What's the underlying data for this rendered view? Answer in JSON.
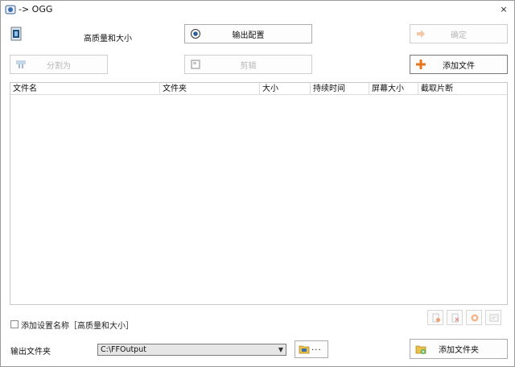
{
  "window": {
    "title": "-> OGG",
    "close_glyph": "×"
  },
  "profile": {
    "label": "高质量和大小"
  },
  "toolbar": {
    "output_config": "输出配置",
    "ok": "确定",
    "split": "分割为",
    "clip": "剪辑",
    "add_file": "添加文件"
  },
  "table": {
    "columns": [
      "文件名",
      "文件夹",
      "大小",
      "持续时间",
      "屏幕大小",
      "截取片断"
    ]
  },
  "options": {
    "append_setting_name": "添加设置名称［高质量和大小］",
    "append_checked": false
  },
  "output": {
    "label": "输出文件夹",
    "folder_value": "C:\\FFOutput",
    "browse_label": "...",
    "add_folder": "添加文件夹"
  },
  "icons": {
    "title": "app-icon",
    "profile": "profile-icon",
    "output_config": "gear-radio-icon",
    "ok": "arrow-right-icon",
    "split": "split-icon",
    "clip": "film-icon",
    "add_file": "plus-icon",
    "remove": "remove-file-icon",
    "clear": "clear-list-icon",
    "play": "play-icon",
    "info": "info-icon",
    "browse": "folder-icon",
    "add_folder": "add-folder-icon"
  },
  "colors": {
    "accent_orange": "#e8741a",
    "disabled_text": "#b8b8b8"
  }
}
